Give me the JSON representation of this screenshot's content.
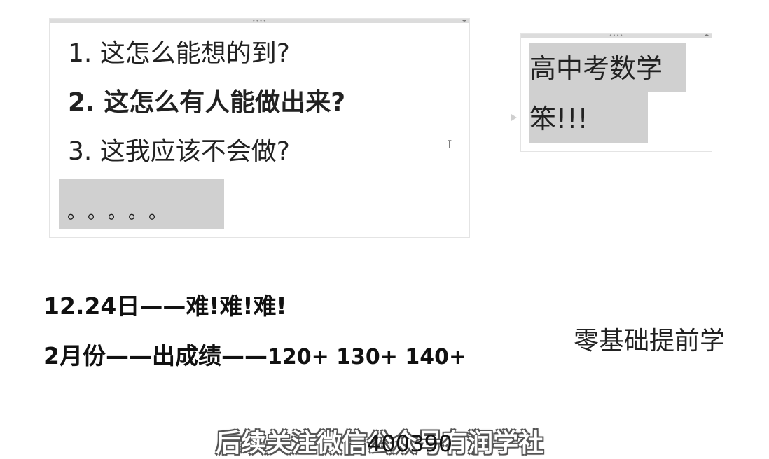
{
  "panel_left": {
    "items": [
      "1. 这怎么能想的到?",
      "2. 这怎么有人能做出来?",
      "3. 这我应该不会做?"
    ],
    "dots": "。。。。。"
  },
  "panel_right": {
    "line1": "高中考数学",
    "line2": "笨!!!"
  },
  "main": {
    "line1": "12.24日——难!难!难!",
    "line2_text": "2月份——出成绩——",
    "line2_scores": "120+ 130+ 140+",
    "right_note": "零基础提前学"
  },
  "overlay": {
    "subtitle": "后续关注微信公众号有润学社",
    "number": "400390"
  },
  "colors": {
    "highlight": "#d0d0d0",
    "panel_bar": "#dcdcdc",
    "text": "#222222"
  },
  "icons": {
    "text_cursor": "text-cursor-icon",
    "arrow_handle": "connector-arrow-icon"
  }
}
